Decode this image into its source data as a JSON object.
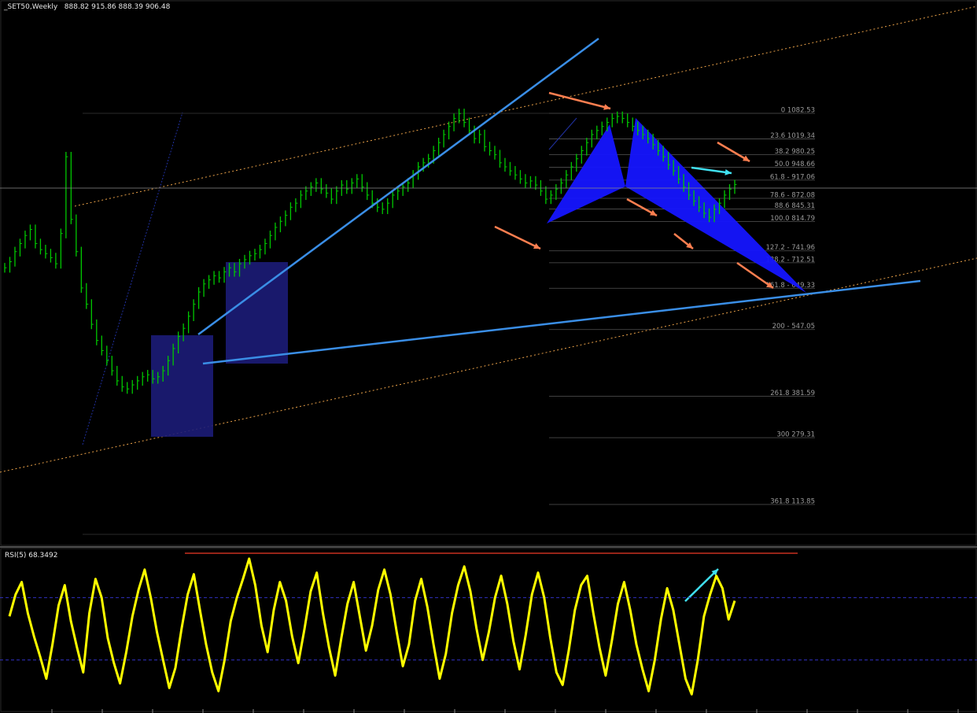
{
  "header": {
    "symbol_timeframe": "_SET50,Weekly",
    "ohlc": "888.82 915.86 888.39 906.48"
  },
  "rsi_panel": {
    "label": "RSI(5) 68.3492"
  },
  "colors": {
    "background": "#000000",
    "bars": "#00c800",
    "trendline": "#3a8ee6",
    "pattern_fill": "#1515ff",
    "box_fill": "#1c1c78",
    "orange_arrow": "#ff7f50",
    "cyan_arrow": "#40e0f0",
    "channel_dotted": "#e8a048",
    "fib_line": "#555555",
    "rsi_line": "#ffff00",
    "rsi_level": "#3030c0",
    "rsi_red_line": "#c83020"
  },
  "chart_data": [
    {
      "type": "line",
      "title": "_SET50,Weekly",
      "style": "ohlc-bars",
      "series": [
        {
          "name": "",
          "values": [
            700,
            715,
            740,
            760,
            780,
            795,
            760,
            745,
            735,
            725,
            710,
            785,
            975,
            820,
            740,
            650,
            610,
            560,
            520,
            495,
            470,
            445,
            420,
            405,
            400,
            410,
            420,
            430,
            435,
            425,
            430,
            445,
            470,
            500,
            530,
            550,
            580,
            610,
            640,
            660,
            670,
            680,
            675,
            690,
            700,
            690,
            710,
            720,
            730,
            735,
            745,
            760,
            780,
            800,
            815,
            830,
            850,
            860,
            880,
            890,
            900,
            910,
            895,
            885,
            870,
            890,
            905,
            895,
            910,
            920,
            900,
            880,
            860,
            850,
            845,
            860,
            880,
            890,
            900,
            910,
            930,
            950,
            960,
            970,
            990,
            1010,
            1030,
            1050,
            1070,
            1082,
            1060,
            1040,
            1020,
            1030,
            1000,
            990,
            980,
            960,
            950,
            940,
            930,
            920,
            910,
            915,
            905,
            890,
            870,
            880,
            895,
            910,
            930,
            950,
            970,
            990,
            1010,
            1030,
            1040,
            1050,
            1060,
            1070,
            1075,
            1070,
            1060,
            1050,
            1040,
            1030,
            1020,
            1005,
            990,
            975,
            955,
            940,
            920,
            900,
            880,
            865,
            850,
            835,
            825,
            845,
            860,
            880,
            895,
            906
          ]
        }
      ],
      "fibonacci": [
        {
          "label": "0 1082.53",
          "value": 1082.53
        },
        {
          "label": "23.6 1019.34",
          "value": 1019.34
        },
        {
          "label": "38.2 980.25",
          "value": 980.25
        },
        {
          "label": "50.0 948.66",
          "value": 948.66
        },
        {
          "label": "61.8 - 917.06",
          "value": 917.06
        },
        {
          "label": "78.6 - 872.08",
          "value": 872.08
        },
        {
          "label": "88.6 845.31",
          "value": 845.31
        },
        {
          "label": "100.0 814.79",
          "value": 814.79
        },
        {
          "label": "127.2 - 741.96",
          "value": 741.96
        },
        {
          "label": "138.2 - 712.51",
          "value": 712.51
        },
        {
          "label": "161.8 - 649.33",
          "value": 649.33
        },
        {
          "label": "200 - 547.05",
          "value": 547.05
        },
        {
          "label": "261.8 381.59",
          "value": 381.59
        },
        {
          "label": "300 279.31",
          "value": 279.31
        },
        {
          "label": "361.8 113.85",
          "value": 113.85
        }
      ]
    },
    {
      "type": "line",
      "title": "RSI(5) 68.3492",
      "ylim": [
        0,
        100
      ],
      "levels": [
        70,
        30
      ],
      "series": [
        {
          "name": "RSI(5)",
          "values": [
            58,
            72,
            80,
            60,
            45,
            32,
            18,
            40,
            65,
            78,
            55,
            38,
            22,
            60,
            82,
            70,
            44,
            28,
            15,
            35,
            58,
            75,
            88,
            70,
            48,
            30,
            12,
            25,
            50,
            72,
            85,
            62,
            40,
            22,
            10,
            30,
            55,
            70,
            82,
            95,
            78,
            52,
            35,
            62,
            80,
            68,
            45,
            28,
            50,
            74,
            86,
            60,
            38,
            20,
            44,
            66,
            80,
            58,
            36,
            52,
            75,
            88,
            72,
            48,
            26,
            40,
            68,
            82,
            64,
            40,
            18,
            34,
            60,
            78,
            90,
            74,
            50,
            30,
            48,
            70,
            84,
            66,
            42,
            24,
            46,
            72,
            86,
            70,
            44,
            22,
            14,
            36,
            62,
            78,
            84,
            60,
            38,
            20,
            42,
            66,
            80,
            62,
            40,
            24,
            10,
            30,
            56,
            76,
            62,
            40,
            18,
            8,
            30,
            58,
            72,
            84,
            76,
            56,
            68
          ]
        }
      ]
    }
  ]
}
